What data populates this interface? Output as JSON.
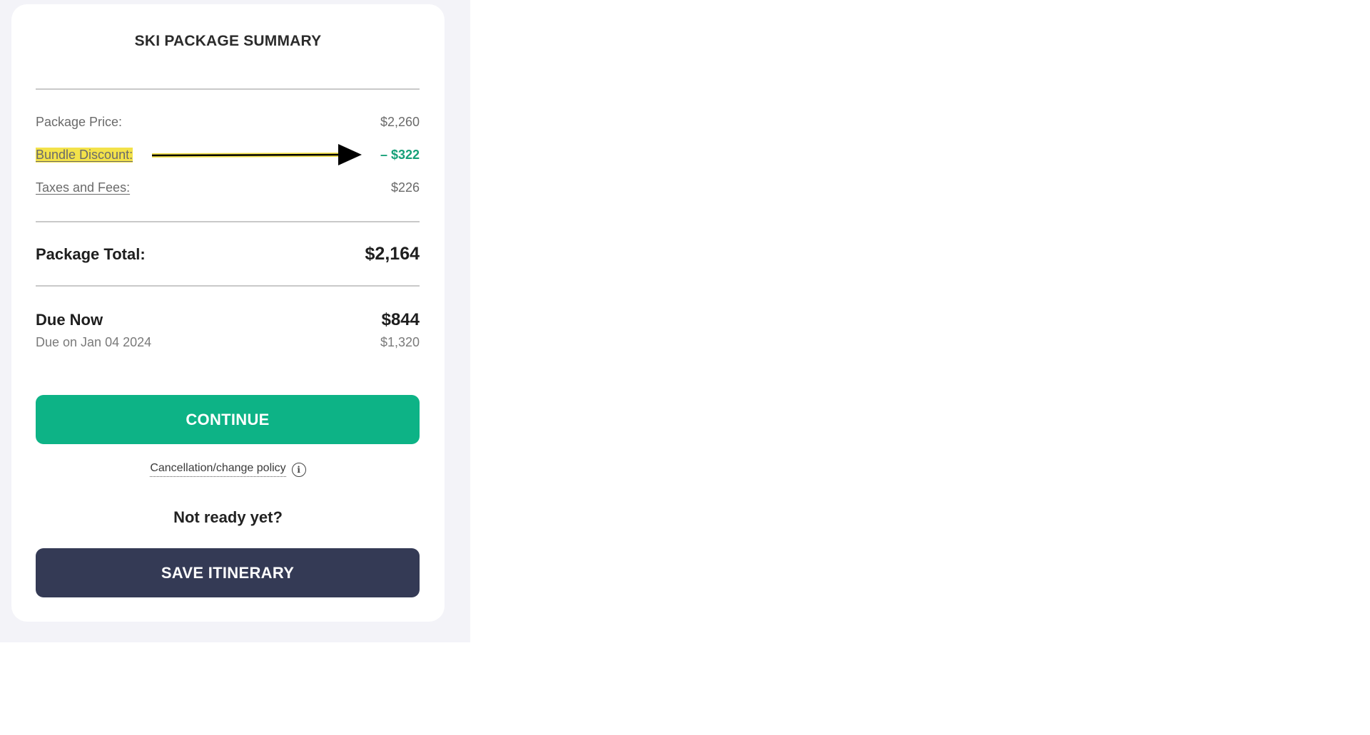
{
  "summary": {
    "title": "SKI PACKAGE SUMMARY",
    "package_price": {
      "label": "Package Price:",
      "value": "$2,260"
    },
    "bundle_discount": {
      "label": "Bundle Discount:",
      "value": "– $322"
    },
    "taxes": {
      "label": "Taxes and Fees:",
      "value": "$226"
    },
    "total": {
      "label": "Package Total:",
      "value": "$2,164"
    },
    "due_now": {
      "label": "Due Now",
      "value": "$844"
    },
    "due_later": {
      "label": "Due on Jan 04 2024",
      "value": "$1,320"
    }
  },
  "actions": {
    "continue_label": "CONTINUE",
    "policy_link": "Cancellation/change policy",
    "not_ready": "Not ready yet?",
    "save_label": "SAVE ITINERARY"
  },
  "icons": {
    "policy_info": "info-icon",
    "annotation": "arrow-annotation"
  },
  "colors": {
    "accent_green": "#0db386",
    "discount_green": "#16a078",
    "dark_button": "#343a55",
    "highlight_yellow": "#f3e24a"
  }
}
